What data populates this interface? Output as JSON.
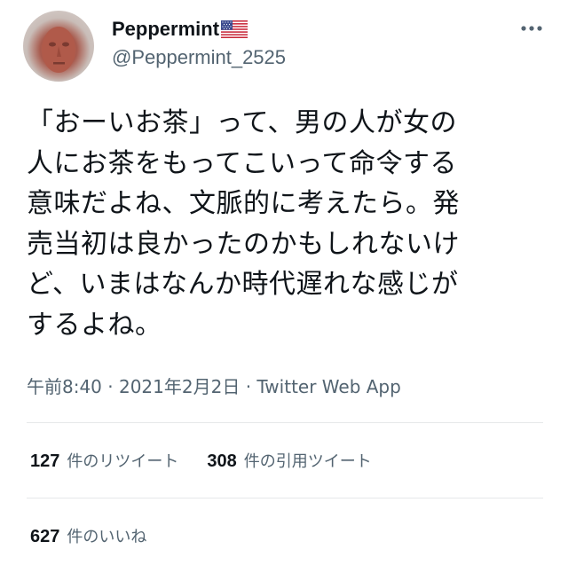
{
  "user": {
    "display_name": "Peppermint",
    "handle": "@Peppermint_2525",
    "flag_icon": "us-flag-icon"
  },
  "more_icon": "ellipsis-icon",
  "tweet": {
    "lines": [
      "「おーいお茶」って、男の人が女の",
      "人にお茶をもってこいって命令する",
      "意味だよね、文脈的に考えたら。発",
      "売当初は良かったのかもしれないけ",
      "ど、いまはなんか時代遅れな感じが",
      "するよね。"
    ],
    "timestamp": "午前8:40 · 2021年2月2日 · Twitter Web App"
  },
  "stats": {
    "retweets": {
      "count": "127",
      "label": "件のリツイート"
    },
    "quotes": {
      "count": "308",
      "label": "件の引用ツイート"
    },
    "likes": {
      "count": "627",
      "label": "件のいいね"
    }
  },
  "colors": {
    "text": "#0f1419",
    "secondary": "#536471",
    "divider": "#e6e8ea"
  }
}
